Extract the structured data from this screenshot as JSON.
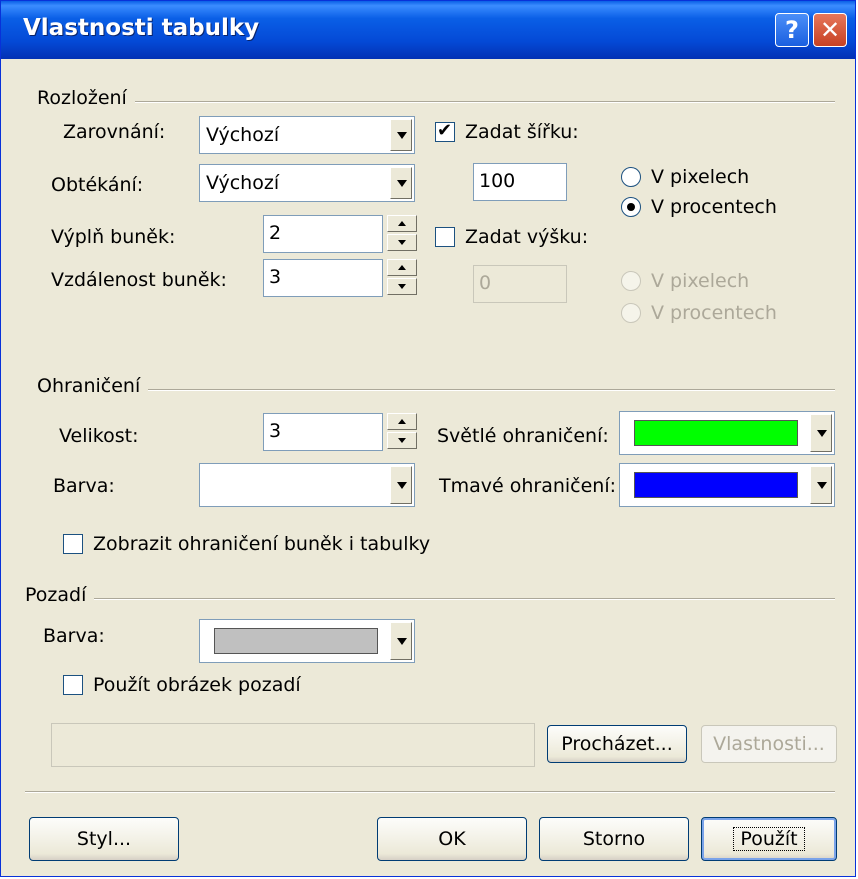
{
  "window": {
    "title": "Vlastnosti tabulky",
    "help_label": "?",
    "close_label": "✕"
  },
  "layout_section": {
    "label": "Rozložení",
    "alignment": {
      "label": "Zarovnání:",
      "value": "Výchozí"
    },
    "float": {
      "label": "Obtékání:",
      "value": "Výchozí"
    },
    "padding": {
      "label": "Výplň buněk:",
      "value": "2"
    },
    "spacing": {
      "label": "Vzdálenost buněk:",
      "value": "3"
    },
    "width": {
      "label": "Zadat šířku:",
      "checked": true,
      "value": "100",
      "unit_pixels": "V pixelech",
      "unit_percent": "V procentech",
      "selected": "percent"
    },
    "height": {
      "label": "Zadat výšku:",
      "checked": false,
      "value": "0",
      "unit_pixels": "V pixelech",
      "unit_percent": "V procentech"
    }
  },
  "borders_section": {
    "label": "Ohraničení",
    "size": {
      "label": "Velikost:",
      "value": "3"
    },
    "color": {
      "label": "Barva:"
    },
    "light_border": {
      "label": "Světlé ohraničení:",
      "color": "#00ff00"
    },
    "dark_border": {
      "label": "Tmavé ohraničení:",
      "color": "#0000ff"
    },
    "show_cell_borders": {
      "label": "Zobrazit ohraničení buněk i tabulky",
      "checked": false
    }
  },
  "background_section": {
    "label": "Pozadí",
    "color": {
      "label": "Barva:",
      "swatch": "#c0c0c0"
    },
    "use_image": {
      "label": "Použít obrázek pozadí",
      "checked": false
    },
    "image_path": "",
    "browse_label": "Procházet...",
    "properties_label": "Vlastnosti..."
  },
  "footer": {
    "style_label": "Styl...",
    "ok_label": "OK",
    "cancel_label": "Storno",
    "apply_label": "Použít"
  }
}
